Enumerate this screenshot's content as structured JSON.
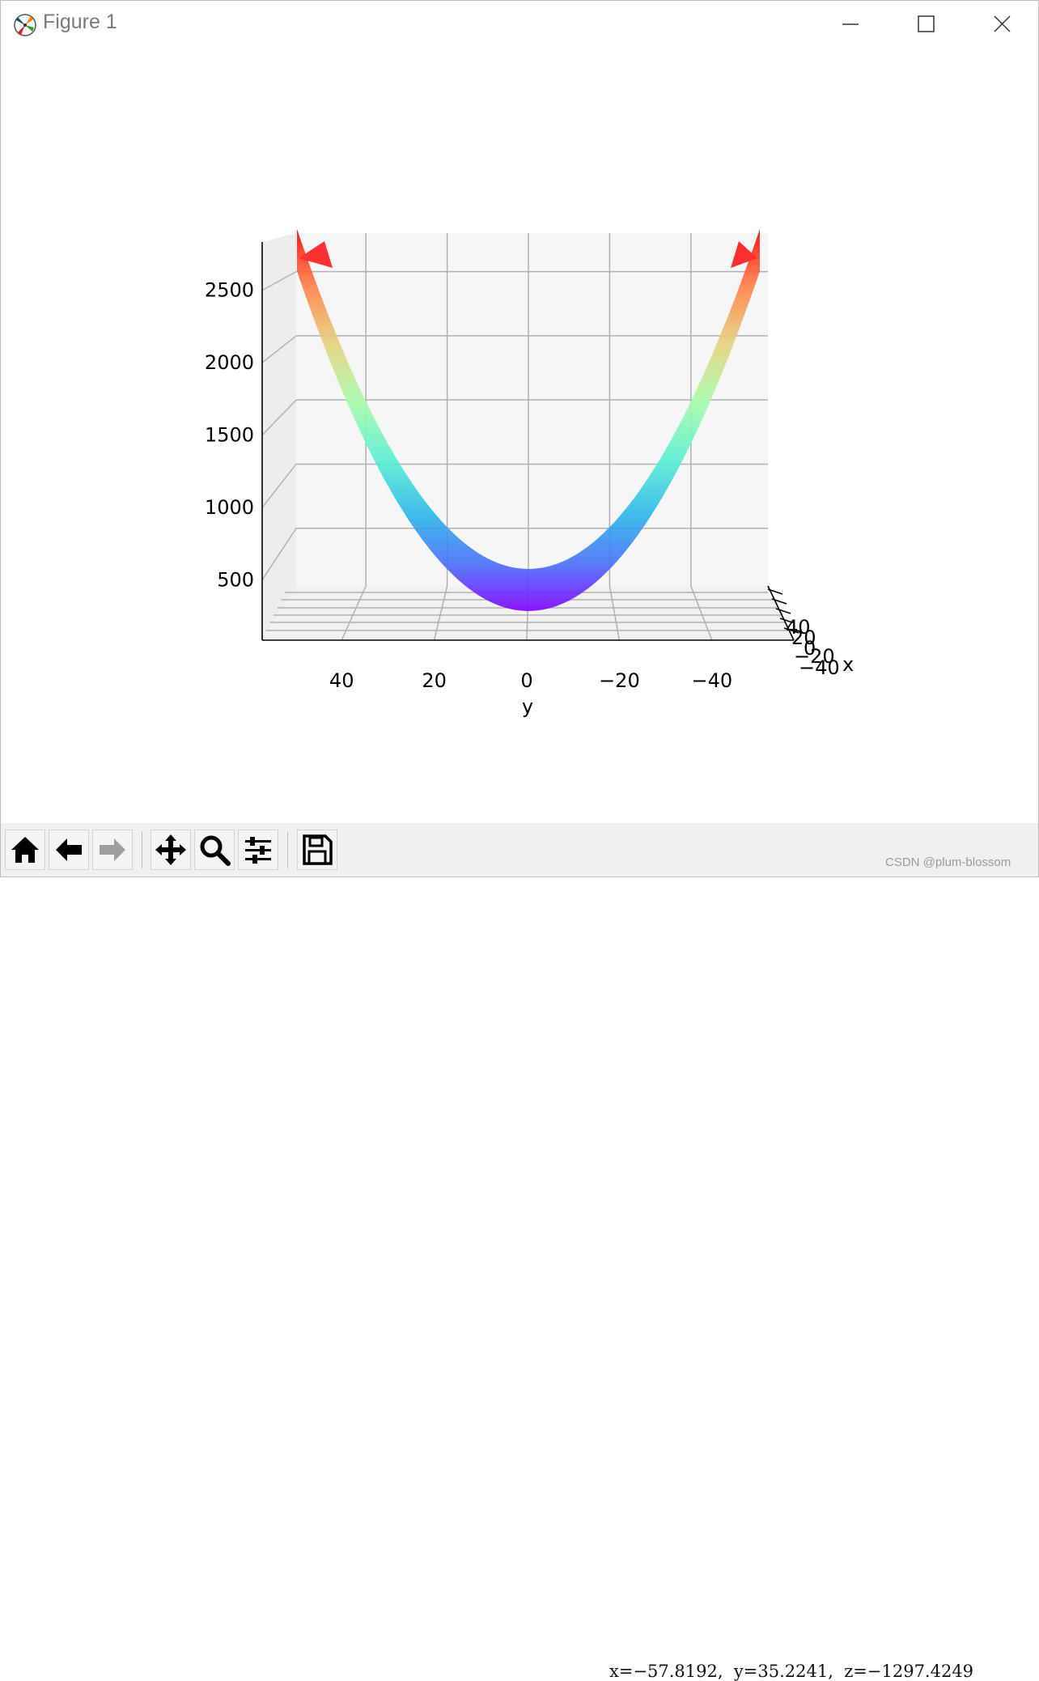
{
  "window": {
    "title": "Figure 1",
    "controls": [
      "minimize",
      "maximize",
      "close"
    ]
  },
  "toolbar": {
    "buttons": [
      {
        "name": "home",
        "icon": "home-icon"
      },
      {
        "name": "back",
        "icon": "arrow-left-icon"
      },
      {
        "name": "forward",
        "icon": "arrow-right-icon",
        "enabled": false
      },
      {
        "name": "pan",
        "icon": "move-icon"
      },
      {
        "name": "zoom",
        "icon": "zoom-icon"
      },
      {
        "name": "configure-subplots",
        "icon": "sliders-icon"
      },
      {
        "name": "save",
        "icon": "save-icon"
      }
    ],
    "coords": "x=−57.8192,  y=35.2241,  z=−1297.4249"
  },
  "watermark": "CSDN @plum-blossom",
  "chart_data": {
    "type": "surface3d",
    "function": "z = x^2 + y^2",
    "colormap": "rainbow",
    "view": "side view along x axis",
    "y_axis": {
      "label": "y",
      "ticks": [
        "40",
        "20",
        "0",
        "−20",
        "−40"
      ],
      "range": [
        55,
        -55
      ],
      "inverted": true
    },
    "z_axis": {
      "label": "",
      "ticks": [
        "500",
        "1000",
        "1500",
        "2000",
        "2500"
      ],
      "range": [
        0,
        2750
      ]
    },
    "x_axis": {
      "label": "x",
      "ticks": [
        "40",
        "20",
        "0",
        "−20",
        "−40"
      ]
    },
    "grid": true
  }
}
